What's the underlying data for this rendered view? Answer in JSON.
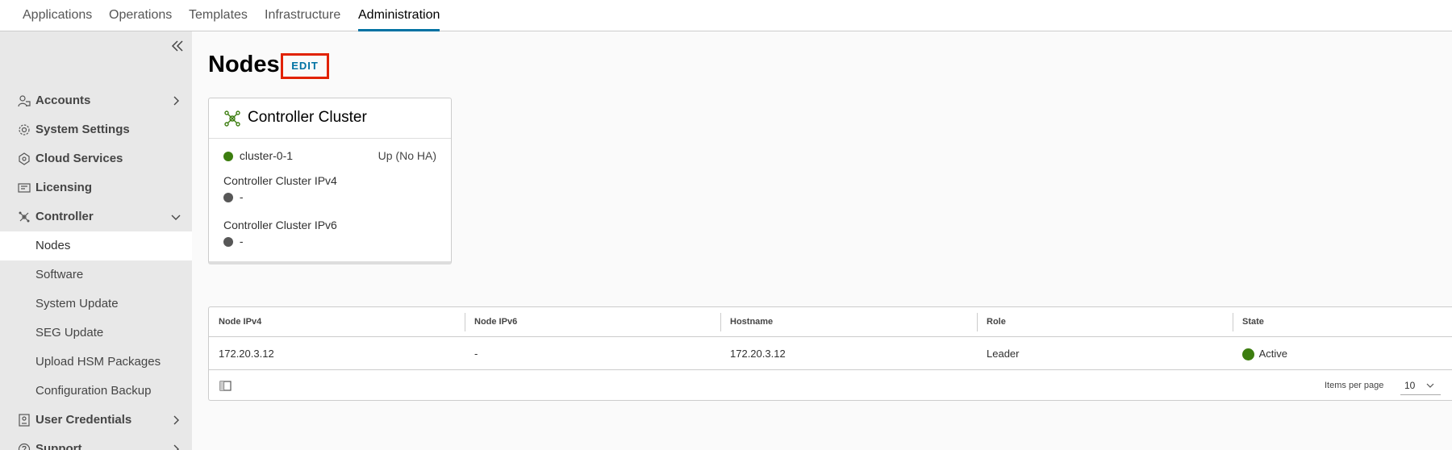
{
  "top_nav": {
    "tabs": [
      {
        "label": "Applications"
      },
      {
        "label": "Operations"
      },
      {
        "label": "Templates"
      },
      {
        "label": "Infrastructure"
      },
      {
        "label": "Administration",
        "active": true
      }
    ]
  },
  "sidebar": {
    "collapse_icon": "double-chevron-left-icon",
    "items": [
      {
        "label": "Accounts",
        "icon": "accounts-icon"
      },
      {
        "label": "System Settings",
        "icon": "gear-icon"
      },
      {
        "label": "Cloud Services",
        "icon": "cloud-services-icon"
      },
      {
        "label": "Licensing",
        "icon": "licensing-icon"
      },
      {
        "label": "Controller",
        "icon": "controller-icon",
        "expanded": true
      },
      {
        "label": "User Credentials",
        "icon": "user-credentials-icon"
      },
      {
        "label": "Support",
        "icon": "help-icon"
      }
    ],
    "controller_sub_items": [
      {
        "label": "Nodes",
        "active": true
      },
      {
        "label": "Software"
      },
      {
        "label": "System Update"
      },
      {
        "label": "SEG Update"
      },
      {
        "label": "Upload HSM Packages"
      },
      {
        "label": "Configuration Backup"
      }
    ]
  },
  "main": {
    "title": "Nodes",
    "edit_label": "EDIT",
    "cluster_card": {
      "title": "Controller Cluster",
      "node_name": "cluster-0-1",
      "node_status": "Up (No HA)",
      "ipv4_label": "Controller Cluster IPv4",
      "ipv4_value": "-",
      "ipv6_label": "Controller Cluster IPv6",
      "ipv6_value": "-"
    },
    "table": {
      "headers": [
        "Node IPv4",
        "Node IPv6",
        "Hostname",
        "Role",
        "State"
      ],
      "rows": [
        {
          "ipv4": "172.20.3.12",
          "ipv6": "-",
          "hostname": "172.20.3.12",
          "role": "Leader",
          "state": "Active"
        }
      ],
      "items_per_page_label": "Items per page",
      "items_per_page_value": "10"
    }
  },
  "colors": {
    "accent": "#0072a3",
    "status_green": "#3c7d0f",
    "highlight_red": "#e12200",
    "status_grey": "#575757"
  }
}
